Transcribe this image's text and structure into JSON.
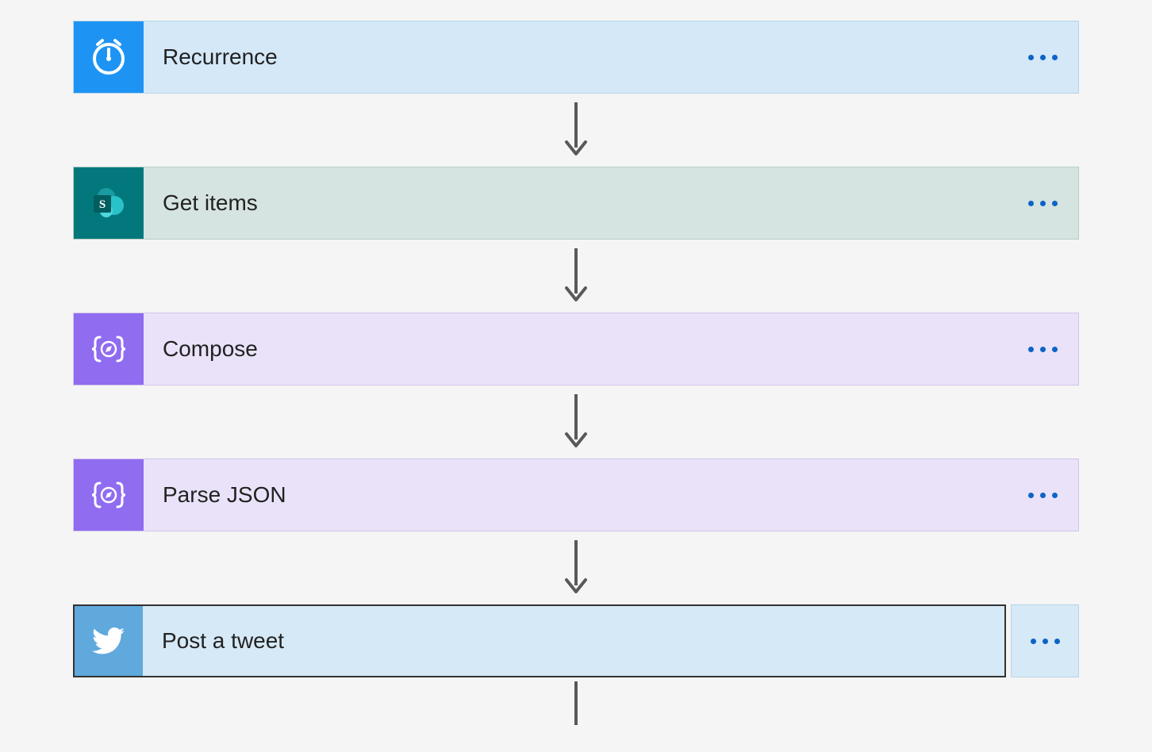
{
  "flow": {
    "steps": [
      {
        "label": "Recurrence",
        "icon": "clock-icon"
      },
      {
        "label": "Get items",
        "icon": "sharepoint-icon"
      },
      {
        "label": "Compose",
        "icon": "braces-pencil-icon"
      },
      {
        "label": "Parse JSON",
        "icon": "braces-pencil-icon"
      },
      {
        "label": "Post a tweet",
        "icon": "twitter-icon"
      }
    ]
  }
}
